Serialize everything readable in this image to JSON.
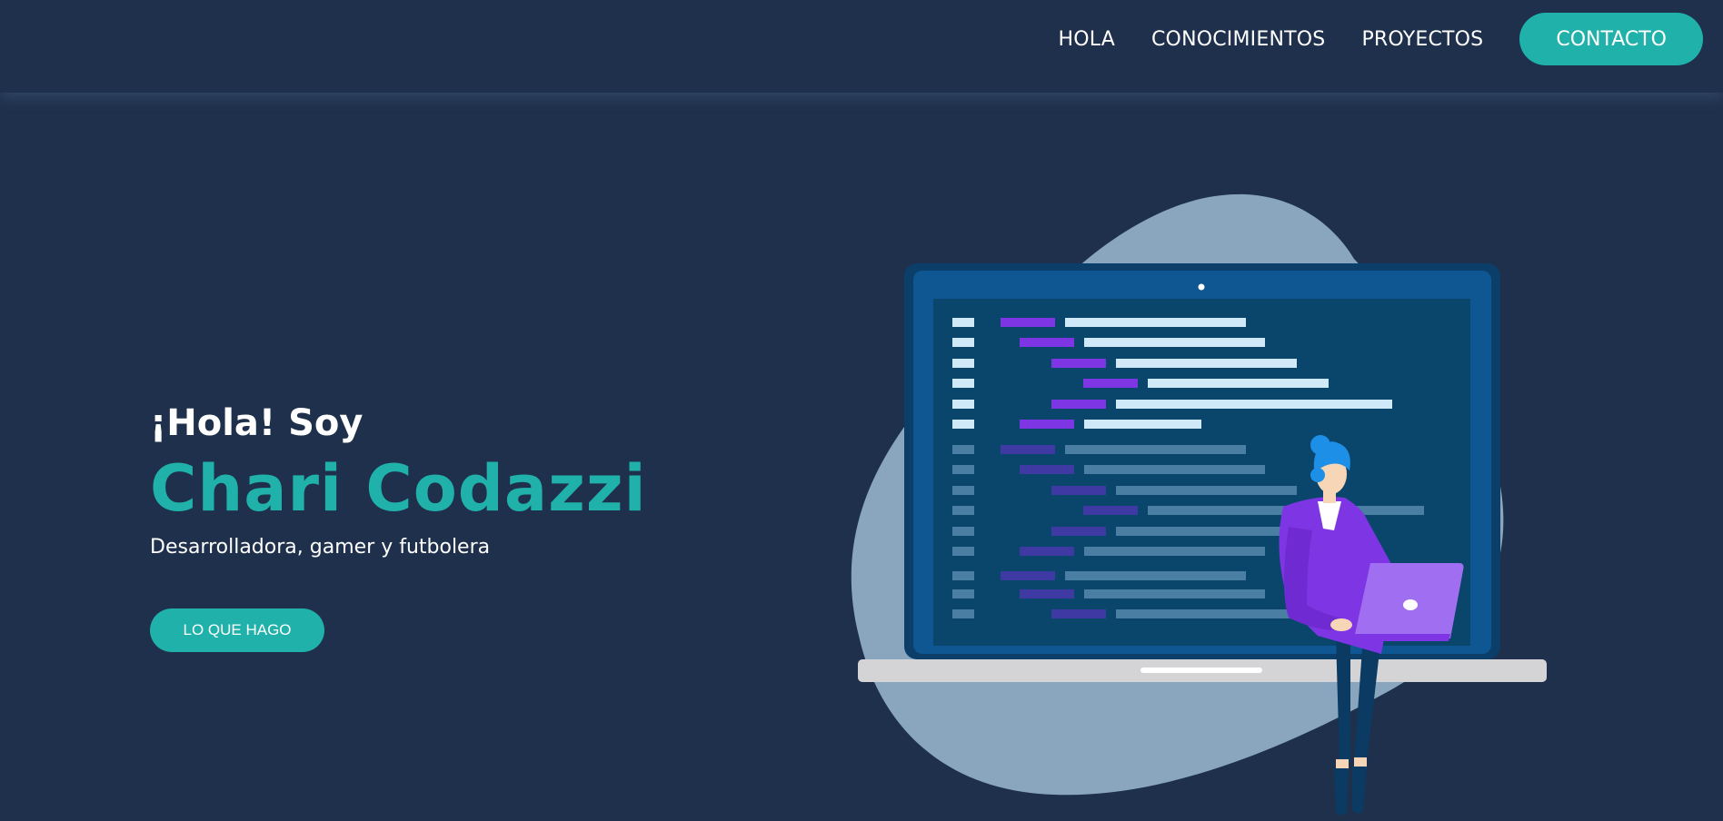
{
  "nav": {
    "links": [
      {
        "label": "HOLA"
      },
      {
        "label": "CONOCIMIENTOS"
      },
      {
        "label": "PROYECTOS"
      }
    ],
    "cta_label": "CONTACTO"
  },
  "hero": {
    "greeting": "¡Hola! Soy",
    "name": "Chari Codazzi",
    "tagline": "Desarrolladora, gamer y futbolera",
    "button_label": "LO QUE HAGO"
  },
  "illustration": {
    "subject": "developer-illustration",
    "icons": [
      "laptop-icon",
      "person-icon",
      "code-lines-icon"
    ]
  },
  "colors": {
    "background": "#1e304b",
    "accent": "#20b2aa",
    "text": "#ffffff",
    "blob": "#8aa6be",
    "screen": "#0e4670",
    "code_purple": "#7e35e4",
    "code_light": "#cfe9f9"
  }
}
